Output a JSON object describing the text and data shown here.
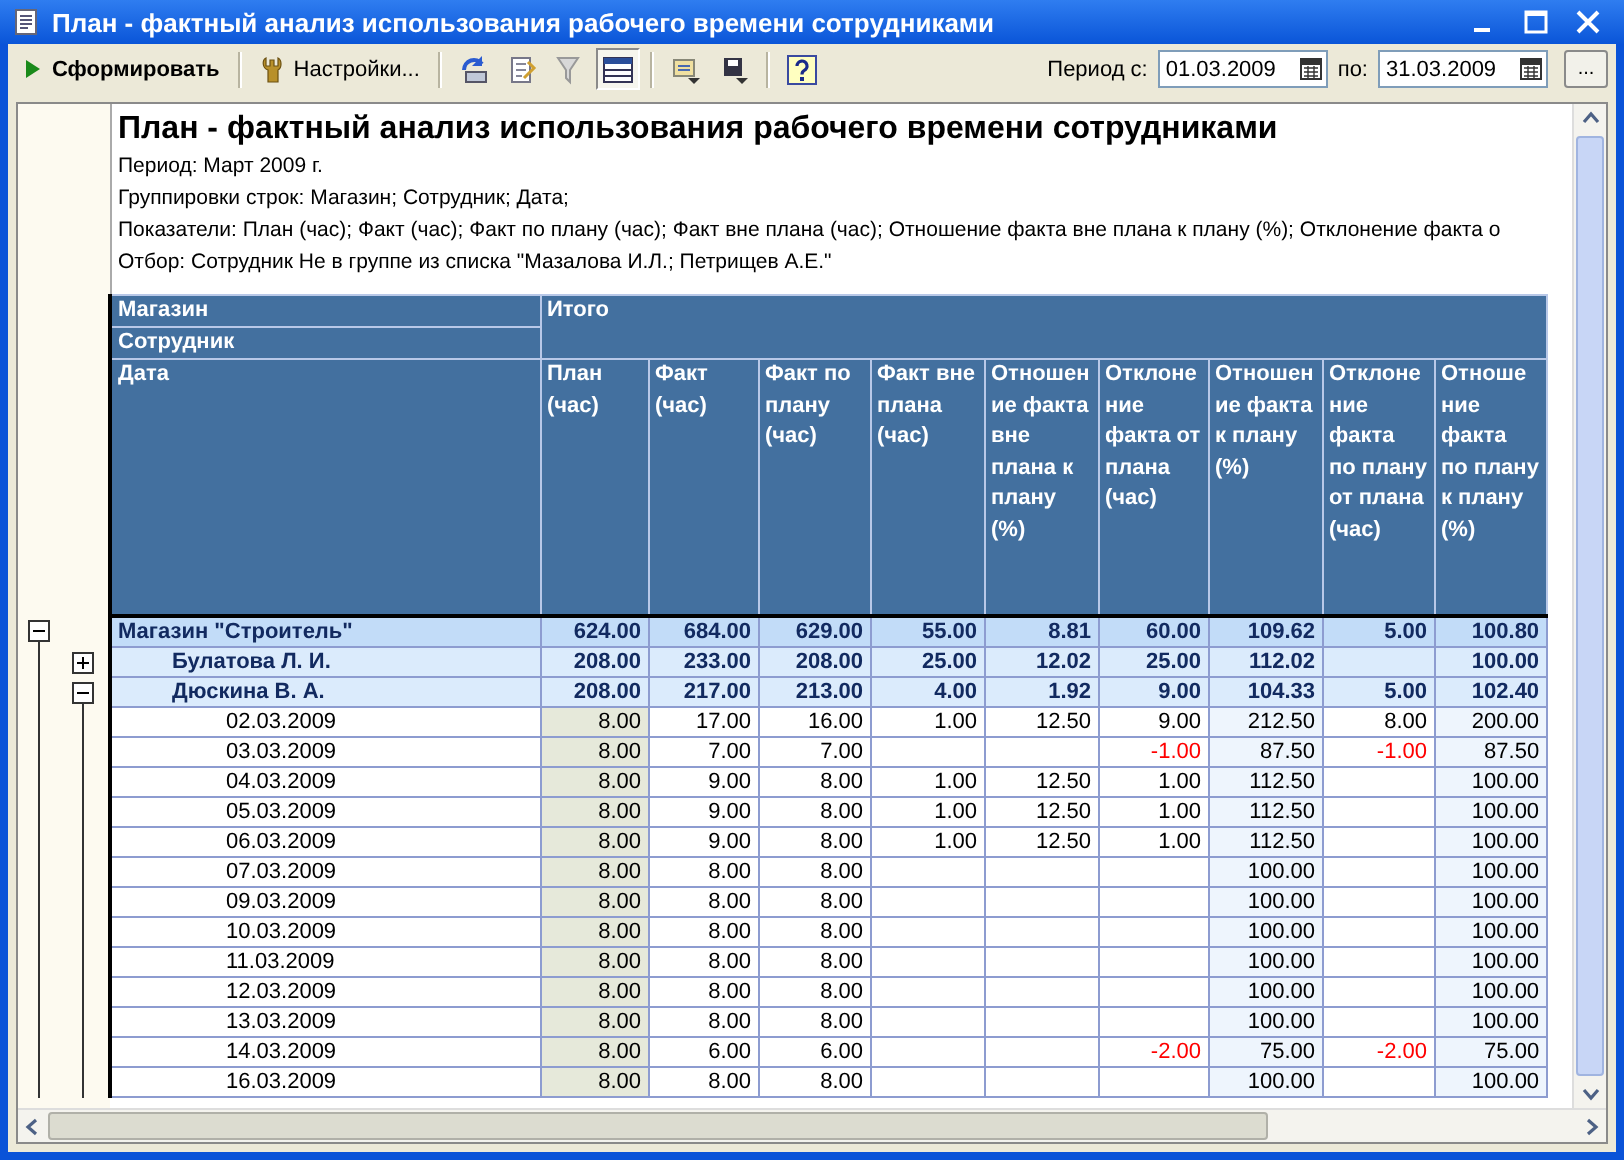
{
  "window": {
    "title": "План - фактный анализ использования рабочего времени сотрудниками"
  },
  "toolbar": {
    "generate": "Сформировать",
    "settings": "Настройки...",
    "icon_buttons": [
      {
        "kind": "refresh",
        "pressed": false
      },
      {
        "kind": "document",
        "pressed": false
      },
      {
        "kind": "filter",
        "pressed": false
      },
      {
        "kind": "table",
        "pressed": true
      },
      {
        "kind": "export",
        "pressed": false
      },
      {
        "kind": "save",
        "pressed": false
      },
      {
        "kind": "help",
        "pressed": false
      }
    ],
    "period_from_label": "Период с:",
    "period_from": "01.03.2009",
    "period_to_label": "по:",
    "period_to": "31.03.2009",
    "more": "..."
  },
  "report": {
    "title": "План - фактный анализ использования рабочего времени сотрудниками",
    "lines": [
      "Период: Март 2009 г.",
      "Группировки строк: Магазин; Сотрудник; Дата;",
      "Показатели: План (час); Факт (час); Факт по плану (час); Факт вне плана (час); Отношение факта вне плана к плану (%); Отклонение факта о",
      "Отбор: Сотрудник Не в группе из списка \"Мазалова И.Л.; Петрищев А.Е.\""
    ]
  },
  "table": {
    "row_headers": [
      "Магазин",
      "Сотрудник",
      "Дата"
    ],
    "group_header": "Итого",
    "columns": [
      "План (час)",
      "Факт (час)",
      "Факт по плану (час)",
      "Факт вне плана (час)",
      "Отношение факта вне плана к плану (%)",
      "Отклонение факта от плана (час)",
      "Отношение факта к плану (%)",
      "Отклонение факта по плану от плана (час)",
      "Отношение факта по плану к плану (%)"
    ],
    "rows": [
      {
        "label": "Магазин \"Строитель\"",
        "expanded": true,
        "values": {
          "plan": "624.00",
          "fact": "684.00",
          "fact_in_plan": "629.00",
          "fact_out_plan": "55.00",
          "ratio_out_plan": "8.81",
          "deviation": "60.00",
          "ratio": "109.62",
          "deviation_in_plan": "5.00",
          "ratio_in_plan": "100.80"
        },
        "children": [
          {
            "label": "Булатова Л. И.",
            "expanded": false,
            "values": {
              "plan": "208.00",
              "fact": "233.00",
              "fact_in_plan": "208.00",
              "fact_out_plan": "25.00",
              "ratio_out_plan": "12.02",
              "deviation": "25.00",
              "ratio": "112.02",
              "ratio_in_plan": "100.00"
            }
          },
          {
            "label": "Дюскина В. А.",
            "expanded": true,
            "values": {
              "plan": "208.00",
              "fact": "217.00",
              "fact_in_plan": "213.00",
              "fact_out_plan": "4.00",
              "ratio_out_plan": "1.92",
              "deviation": "9.00",
              "ratio": "104.33",
              "deviation_in_plan": "5.00",
              "ratio_in_plan": "102.40"
            },
            "children": [
              {
                "label": "02.03.2009",
                "values": {
                  "plan": "8.00",
                  "fact": "17.00",
                  "fact_in_plan": "16.00",
                  "fact_out_plan": "1.00",
                  "ratio_out_plan": "12.50",
                  "deviation": "9.00",
                  "ratio": "212.50",
                  "deviation_in_plan": "8.00",
                  "ratio_in_plan": "200.00"
                }
              },
              {
                "label": "03.03.2009",
                "values": {
                  "plan": "8.00",
                  "fact": "7.00",
                  "fact_in_plan": "7.00",
                  "deviation": "-1.00",
                  "ratio": "87.50",
                  "deviation_in_plan": "-1.00",
                  "ratio_in_plan": "87.50"
                },
                "deviation_negative": true,
                "deviation_in_plan_negative": true
              },
              {
                "label": "04.03.2009",
                "values": {
                  "plan": "8.00",
                  "fact": "9.00",
                  "fact_in_plan": "8.00",
                  "fact_out_plan": "1.00",
                  "ratio_out_plan": "12.50",
                  "deviation": "1.00",
                  "ratio": "112.50",
                  "ratio_in_plan": "100.00"
                }
              },
              {
                "label": "05.03.2009",
                "values": {
                  "plan": "8.00",
                  "fact": "9.00",
                  "fact_in_plan": "8.00",
                  "fact_out_plan": "1.00",
                  "ratio_out_plan": "12.50",
                  "deviation": "1.00",
                  "ratio": "112.50",
                  "ratio_in_plan": "100.00"
                }
              },
              {
                "label": "06.03.2009",
                "values": {
                  "plan": "8.00",
                  "fact": "9.00",
                  "fact_in_plan": "8.00",
                  "fact_out_plan": "1.00",
                  "ratio_out_plan": "12.50",
                  "deviation": "1.00",
                  "ratio": "112.50",
                  "ratio_in_plan": "100.00"
                }
              },
              {
                "label": "07.03.2009",
                "values": {
                  "plan": "8.00",
                  "fact": "8.00",
                  "fact_in_plan": "8.00",
                  "ratio": "100.00",
                  "ratio_in_plan": "100.00"
                }
              },
              {
                "label": "09.03.2009",
                "values": {
                  "plan": "8.00",
                  "fact": "8.00",
                  "fact_in_plan": "8.00",
                  "ratio": "100.00",
                  "ratio_in_plan": "100.00"
                }
              },
              {
                "label": "10.03.2009",
                "values": {
                  "plan": "8.00",
                  "fact": "8.00",
                  "fact_in_plan": "8.00",
                  "ratio": "100.00",
                  "ratio_in_plan": "100.00"
                }
              },
              {
                "label": "11.03.2009",
                "values": {
                  "plan": "8.00",
                  "fact": "8.00",
                  "fact_in_plan": "8.00",
                  "ratio": "100.00",
                  "ratio_in_plan": "100.00"
                }
              },
              {
                "label": "12.03.2009",
                "values": {
                  "plan": "8.00",
                  "fact": "8.00",
                  "fact_in_plan": "8.00",
                  "ratio": "100.00",
                  "ratio_in_plan": "100.00"
                }
              },
              {
                "label": "13.03.2009",
                "values": {
                  "plan": "8.00",
                  "fact": "8.00",
                  "fact_in_plan": "8.00",
                  "ratio": "100.00",
                  "ratio_in_plan": "100.00"
                }
              },
              {
                "label": "14.03.2009",
                "values": {
                  "plan": "8.00",
                  "fact": "6.00",
                  "fact_in_plan": "6.00",
                  "deviation": "-2.00",
                  "ratio": "75.00",
                  "deviation_in_plan": "-2.00",
                  "ratio_in_plan": "75.00"
                },
                "deviation_negative": true,
                "deviation_in_plan_negative": true
              },
              {
                "label": "16.03.2009",
                "values": {
                  "plan": "8.00",
                  "fact": "8.00",
                  "fact_in_plan": "8.00",
                  "ratio": "100.00",
                  "ratio_in_plan": "100.00"
                }
              }
            ]
          }
        ]
      }
    ]
  }
}
